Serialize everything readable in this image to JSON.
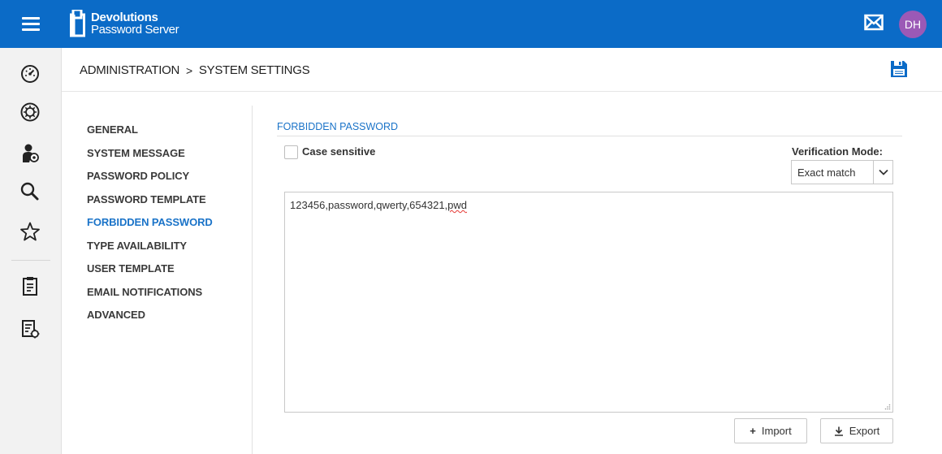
{
  "app": {
    "brand_line1": "Devolutions",
    "brand_line2": "Password Server",
    "user_initials": "DH"
  },
  "colors": {
    "topbar": "#0b6bc7",
    "accent": "#1a73c8",
    "avatar": "#9b59b6"
  },
  "leftnav": {
    "icons": [
      "dashboard-icon",
      "vault-icon",
      "user-management-icon",
      "search-icon",
      "favorites-star-icon",
      "reports-icon",
      "logs-icon"
    ]
  },
  "header": {
    "crumb_root": "ADMINISTRATION",
    "crumb_separator": ">",
    "crumb_current": "SYSTEM SETTINGS"
  },
  "settings_menu": {
    "items": [
      {
        "label": "GENERAL"
      },
      {
        "label": "SYSTEM MESSAGE"
      },
      {
        "label": "PASSWORD POLICY"
      },
      {
        "label": "PASSWORD TEMPLATE"
      },
      {
        "label": "FORBIDDEN PASSWORD",
        "active": true
      },
      {
        "label": "TYPE AVAILABILITY"
      },
      {
        "label": "USER TEMPLATE"
      },
      {
        "label": "EMAIL NOTIFICATIONS"
      },
      {
        "label": "ADVANCED"
      }
    ]
  },
  "forbidden": {
    "section_title": "FORBIDDEN PASSWORD",
    "case_sensitive_label": "Case sensitive",
    "case_sensitive_checked": false,
    "verification_label": "Verification Mode:",
    "verification_value": "Exact match",
    "passwords_text_main": "123456,password,qwerty,654321,",
    "passwords_text_flagged": "pwd",
    "import_label": "Import",
    "export_label": "Export"
  }
}
